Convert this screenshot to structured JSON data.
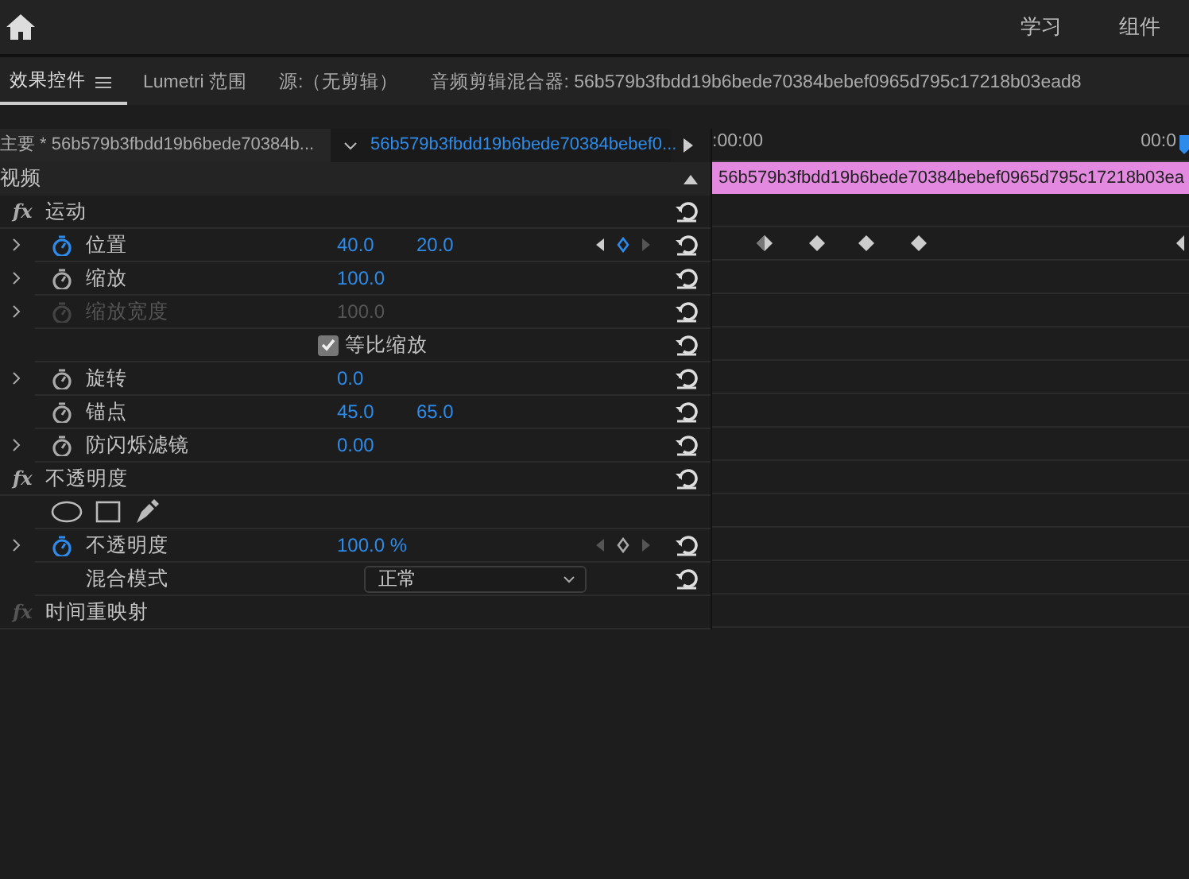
{
  "top_bar": {
    "nav_items": [
      {
        "label": "学习"
      },
      {
        "label": "组件"
      }
    ]
  },
  "tabs": [
    {
      "label": "效果控件",
      "selected": true,
      "menu": true
    },
    {
      "label": "Lumetri 范围",
      "selected": false,
      "menu": false
    },
    {
      "label": "源:（无剪辑）",
      "selected": false,
      "menu": false
    },
    {
      "label": "音频剪辑混合器: 56b579b3fbdd19b6bede70384bebef0965d795c17218b03ead8",
      "selected": false,
      "menu": false
    }
  ],
  "clip_header": {
    "master": "主要 * 56b579b3fbdd19b6bede70384b...",
    "clip": "56b579b3fbdd19b6bede70384bebef0...",
    "time_start": ":00:00",
    "time_end": "00:0"
  },
  "section": {
    "label": "视频",
    "clip_bar": "56b579b3fbdd19b6bede70384bebef0965d795c17218b03ea"
  },
  "effects": [
    {
      "kind": "group",
      "fx": "fx",
      "label": "运动",
      "enabled": true,
      "reset": true
    },
    {
      "kind": "property",
      "label": "位置",
      "expander": true,
      "animated": true,
      "disabled": false,
      "values": [
        "40.0",
        "20.0"
      ],
      "keyframe_nav": true,
      "nav_active": true,
      "keyframes": true
    },
    {
      "kind": "property",
      "label": "缩放",
      "expander": true,
      "animated": false,
      "disabled": false,
      "values": [
        "100.0"
      ],
      "keyframe_nav": false,
      "keyframes": false
    },
    {
      "kind": "property",
      "label": "缩放宽度",
      "expander": true,
      "animated": false,
      "disabled": true,
      "values": [
        "100.0"
      ],
      "keyframe_nav": false,
      "keyframes": false
    },
    {
      "kind": "checkbox",
      "label": "等比缩放",
      "checked": true
    },
    {
      "kind": "property",
      "label": "旋转",
      "expander": true,
      "animated": false,
      "disabled": false,
      "values": [
        "0.0"
      ],
      "keyframe_nav": false,
      "keyframes": false
    },
    {
      "kind": "property",
      "label": "锚点",
      "expander": false,
      "animated": false,
      "disabled": false,
      "values": [
        "45.0",
        "65.0"
      ],
      "keyframe_nav": false,
      "keyframes": false
    },
    {
      "kind": "property",
      "label": "防闪烁滤镜",
      "expander": true,
      "animated": false,
      "disabled": false,
      "values": [
        "0.00"
      ],
      "keyframe_nav": false,
      "keyframes": false
    },
    {
      "kind": "group",
      "fx": "fx",
      "label": "不透明度",
      "enabled": true,
      "reset": true
    },
    {
      "kind": "masks"
    },
    {
      "kind": "property",
      "label": "不透明度",
      "expander": true,
      "animated": true,
      "disabled": false,
      "values": [
        "100.0 %"
      ],
      "keyframe_nav": true,
      "nav_active": false,
      "keyframes": false
    },
    {
      "kind": "dropdown",
      "label": "混合模式",
      "value": "正常"
    },
    {
      "kind": "group",
      "fx": "fx",
      "label": "时间重映射",
      "enabled": false,
      "reset": false
    }
  ]
}
